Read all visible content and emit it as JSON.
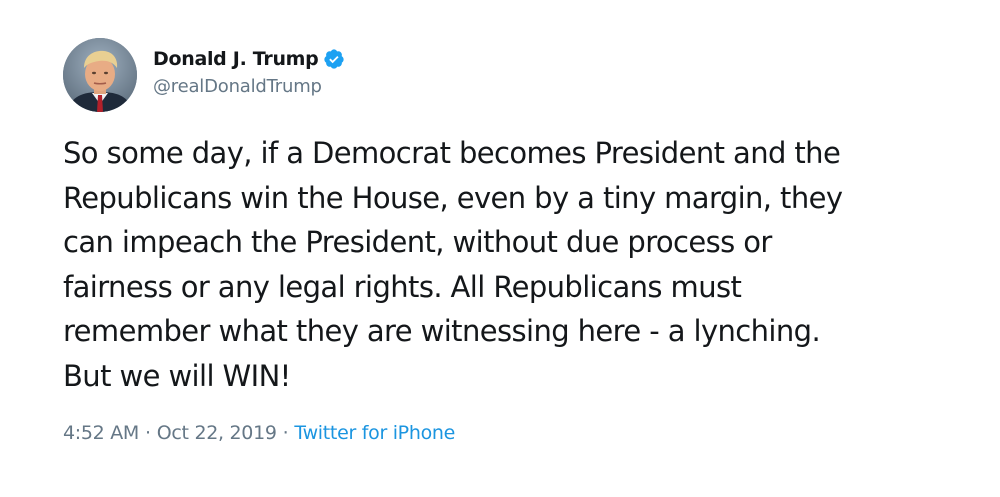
{
  "tweet": {
    "author": {
      "display_name": "Donald J. Trump",
      "handle": "@realDonaldTrump",
      "verified": true,
      "verified_badge_color": "#1da1f2"
    },
    "text": "So some day, if a Democrat becomes President and the\nRepublicans win the House, even by a tiny margin, they\ncan impeach the President, without due process or\nfairness or any legal rights. All Republicans must\nremember what they are witnessing here - a lynching.\nBut we will WIN!",
    "time": "4:52 AM",
    "date": "Oct 22, 2019",
    "separator": "·",
    "source": "Twitter for iPhone"
  },
  "colors": {
    "text": "#14171a",
    "secondary": "#657786",
    "link": "#1b95e0",
    "background": "#ffffff"
  },
  "icons": {
    "avatar": "profile-photo",
    "verified": "verified-badge-icon"
  }
}
